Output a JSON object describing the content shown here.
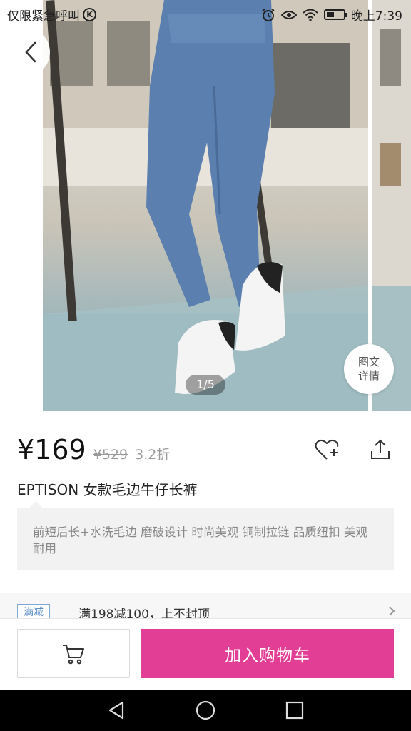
{
  "status_bar": {
    "left_text": "仅限紧急呼叫",
    "k_badge": "K",
    "time": "晚上7:39",
    "battery_level": 0.45
  },
  "gallery": {
    "page_indicator": "1/5",
    "detail_button_line1": "图文",
    "detail_button_line2": "详情"
  },
  "product": {
    "price": "¥169",
    "original_price": "¥529",
    "discount": "3.2折",
    "title": "EPTISON 女款毛边牛仔长裤",
    "description": "前短后长+水洗毛边 磨破设计 时尚美观 铜制拉链 品质纽扣 美观耐用"
  },
  "promotion": {
    "tag": "满减",
    "text": "满198减100，上不封顶"
  },
  "actions": {
    "add_to_cart_label": "加入购物车"
  },
  "icons": {
    "back": "back-arrow-icon",
    "favorite": "heart-plus-icon",
    "share": "share-icon",
    "cart": "cart-icon",
    "chevron": "chevron-right-icon",
    "nav_back": "nav-back-icon",
    "nav_home": "nav-home-icon",
    "nav_recents": "nav-recents-icon"
  },
  "colors": {
    "accent": "#e23e96",
    "promo_tag": "#5e8fc9"
  }
}
